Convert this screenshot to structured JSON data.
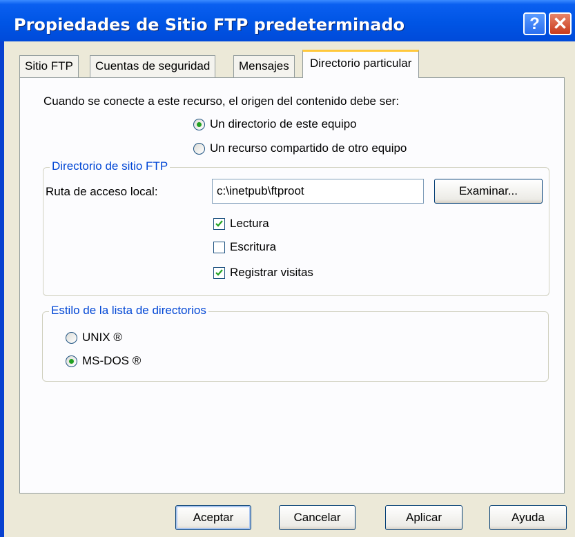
{
  "window": {
    "title": "Propiedades de Sitio FTP predeterminado",
    "help_label": "?",
    "close_label": "✕"
  },
  "tabs": [
    {
      "label": "Sitio FTP"
    },
    {
      "label": "Cuentas de seguridad"
    },
    {
      "label": "Mensajes"
    },
    {
      "label": "Directorio particular",
      "active": true
    }
  ],
  "source": {
    "prompt": "Cuando se conecte a este recurso, el origen del contenido debe ser:",
    "options": [
      {
        "label": "Un directorio de este equipo",
        "selected": true
      },
      {
        "label": "Un recurso compartido de otro equipo",
        "selected": false
      }
    ]
  },
  "ftp_directory": {
    "group_label": "Directorio de sitio FTP",
    "path_label": "Ruta de acceso local:",
    "path_value": "c:\\inetpub\\ftproot",
    "browse_label": "Examinar...",
    "checkboxes": [
      {
        "label": "Lectura",
        "checked": true
      },
      {
        "label": "Escritura",
        "checked": false
      },
      {
        "label": "Registrar visitas",
        "checked": true
      }
    ]
  },
  "listing_style": {
    "group_label": "Estilo de la lista de directorios",
    "options": [
      {
        "label": "UNIX ®",
        "selected": false
      },
      {
        "label": "MS-DOS ®",
        "selected": true
      }
    ]
  },
  "buttons": {
    "ok": "Aceptar",
    "cancel": "Cancelar",
    "apply": "Aplicar",
    "help": "Ayuda"
  },
  "colors": {
    "titlebar": "#0055e5",
    "accent_tab": "#ffc83c",
    "group_label": "#0046d5",
    "radio_dot": "#21a121"
  }
}
